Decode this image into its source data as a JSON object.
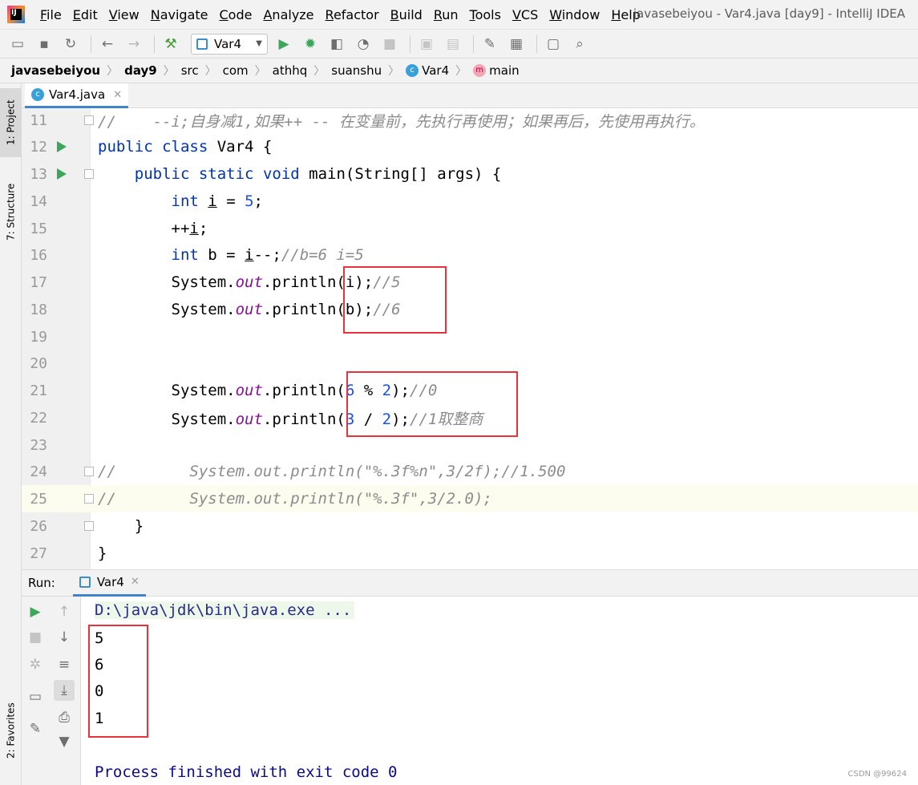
{
  "window": {
    "title": "javasebeiyou - Var4.java [day9] - IntelliJ IDEA",
    "logo_text": "IJ"
  },
  "menu": [
    "File",
    "Edit",
    "View",
    "Navigate",
    "Code",
    "Analyze",
    "Refactor",
    "Build",
    "Run",
    "Tools",
    "VCS",
    "Window",
    "Help"
  ],
  "toolbar": {
    "run_config": "Var4"
  },
  "breadcrumb": [
    "javasebeiyou",
    "day9",
    "src",
    "com",
    "athhq",
    "suanshu",
    "Var4",
    "main"
  ],
  "side_tabs": {
    "project": "1: Project",
    "structure": "7: Structure",
    "favorites": "2: Favorites"
  },
  "editor_tab": {
    "file": "Var4.java"
  },
  "code_lines": [
    {
      "no": "11",
      "text": "//    --i;自身减1,如果++ -- 在变量前，先执行再使用；如果再后，先使用再执行。"
    },
    {
      "no": "12",
      "text": "public class Var4 {"
    },
    {
      "no": "13",
      "text": "    public static void main(String[] args) {"
    },
    {
      "no": "14",
      "text": "        int i = 5;"
    },
    {
      "no": "15",
      "text": "        ++i;"
    },
    {
      "no": "16",
      "text": "        int b = i--;//b=6 i=5"
    },
    {
      "no": "17",
      "text": "        System.out.println(i);//5"
    },
    {
      "no": "18",
      "text": "        System.out.println(b);//6"
    },
    {
      "no": "19",
      "text": ""
    },
    {
      "no": "20",
      "text": ""
    },
    {
      "no": "21",
      "text": "        System.out.println(6 % 2);//0"
    },
    {
      "no": "22",
      "text": "        System.out.println(3 / 2);//1取整商"
    },
    {
      "no": "23",
      "text": ""
    },
    {
      "no": "24",
      "text": "//        System.out.println(\"%.3f%n\",3/2f);//1.500"
    },
    {
      "no": "25",
      "text": "//        System.out.println(\"%.3f\",3/2.0);"
    },
    {
      "no": "26",
      "text": "    }"
    },
    {
      "no": "27",
      "text": "}"
    }
  ],
  "run_panel": {
    "label": "Run:",
    "tab": "Var4",
    "command": "D:\\java\\jdk\\bin\\java.exe ...",
    "output": [
      "5",
      "6",
      "0",
      "1"
    ],
    "exit": "Process finished with exit code 0"
  },
  "watermark": "CSDN @99624"
}
